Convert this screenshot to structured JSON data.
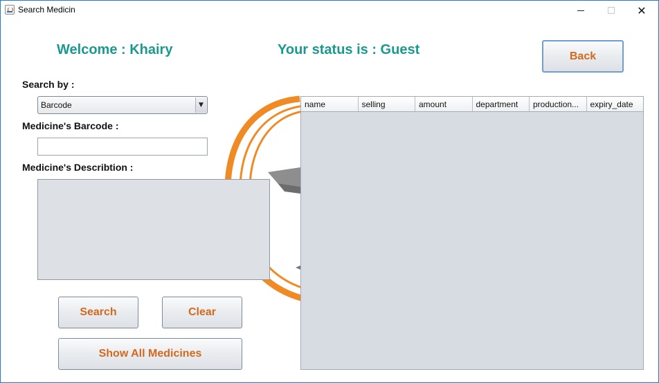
{
  "window": {
    "title": "Search Medicin",
    "controls": {
      "minimize": "minimize",
      "maximize": "maximize",
      "close": "✕"
    }
  },
  "header": {
    "welcome": "Welcome : Khairy",
    "status": "Your status is : Guest",
    "back_label": "Back"
  },
  "form": {
    "search_by_label": "Search by :",
    "search_by_selected": "Barcode",
    "barcode_label": "Medicine's Barcode :",
    "barcode_value": "",
    "description_label": "Medicine's Describtion :",
    "description_value": ""
  },
  "buttons": {
    "search": "Search",
    "clear": "Clear",
    "show_all": "Show All Medicines"
  },
  "table": {
    "columns": [
      "name",
      "selling",
      "amount",
      "department",
      "production...",
      "expiry_date"
    ],
    "rows": []
  },
  "colors": {
    "accent_teal": "#1a9a8e",
    "button_text": "#d2691e",
    "logo_orange": "#f08a24"
  },
  "icons": {
    "app": "java-icon",
    "combo_arrow": "chevron-down-icon"
  }
}
